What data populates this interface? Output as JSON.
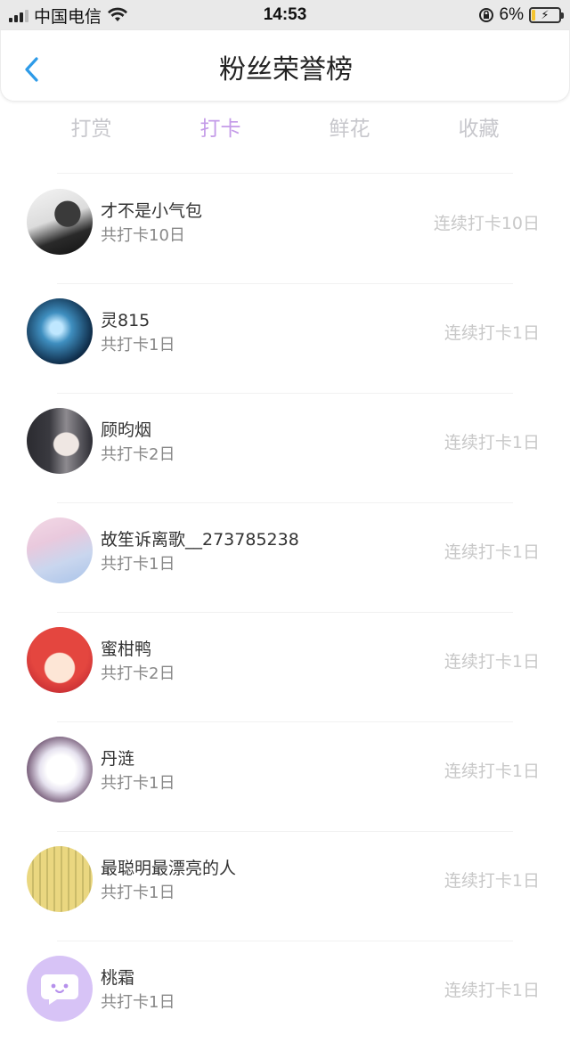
{
  "status_bar": {
    "carrier": "中国电信",
    "time": "14:53",
    "battery_percent": "6%",
    "icons": [
      "signal-icon",
      "wifi-icon",
      "rotation-lock-icon",
      "battery-charging-icon"
    ]
  },
  "nav": {
    "title": "粉丝荣誉榜",
    "back_icon": "chevron-left-icon",
    "accent": "#2e9be8"
  },
  "tabs": [
    {
      "label": "打赏",
      "active": false
    },
    {
      "label": "打卡",
      "active": true
    },
    {
      "label": "鲜花",
      "active": false
    },
    {
      "label": "收藏",
      "active": false
    }
  ],
  "colors": {
    "tab_active": "#c49be8",
    "tab_inactive": "#c7c7cc",
    "streak_text": "#c8c8c8"
  },
  "fans": [
    {
      "name": "才不是小气包",
      "total": "共打卡10日",
      "streak": "连续打卡10日"
    },
    {
      "name": "灵815",
      "total": "共打卡1日",
      "streak": "连续打卡1日"
    },
    {
      "name": "顾昀烟",
      "total": "共打卡2日",
      "streak": "连续打卡1日"
    },
    {
      "name": "故笙诉离歌__273785238",
      "total": "共打卡1日",
      "streak": "连续打卡1日"
    },
    {
      "name": "蜜柑鸭",
      "total": "共打卡2日",
      "streak": "连续打卡1日"
    },
    {
      "name": "丹涟",
      "total": "共打卡1日",
      "streak": "连续打卡1日"
    },
    {
      "name": "最聪明最漂亮的人",
      "total": "共打卡1日",
      "streak": "连续打卡1日"
    },
    {
      "name": "桃霜",
      "total": "共打卡1日",
      "streak": "连续打卡1日"
    }
  ]
}
